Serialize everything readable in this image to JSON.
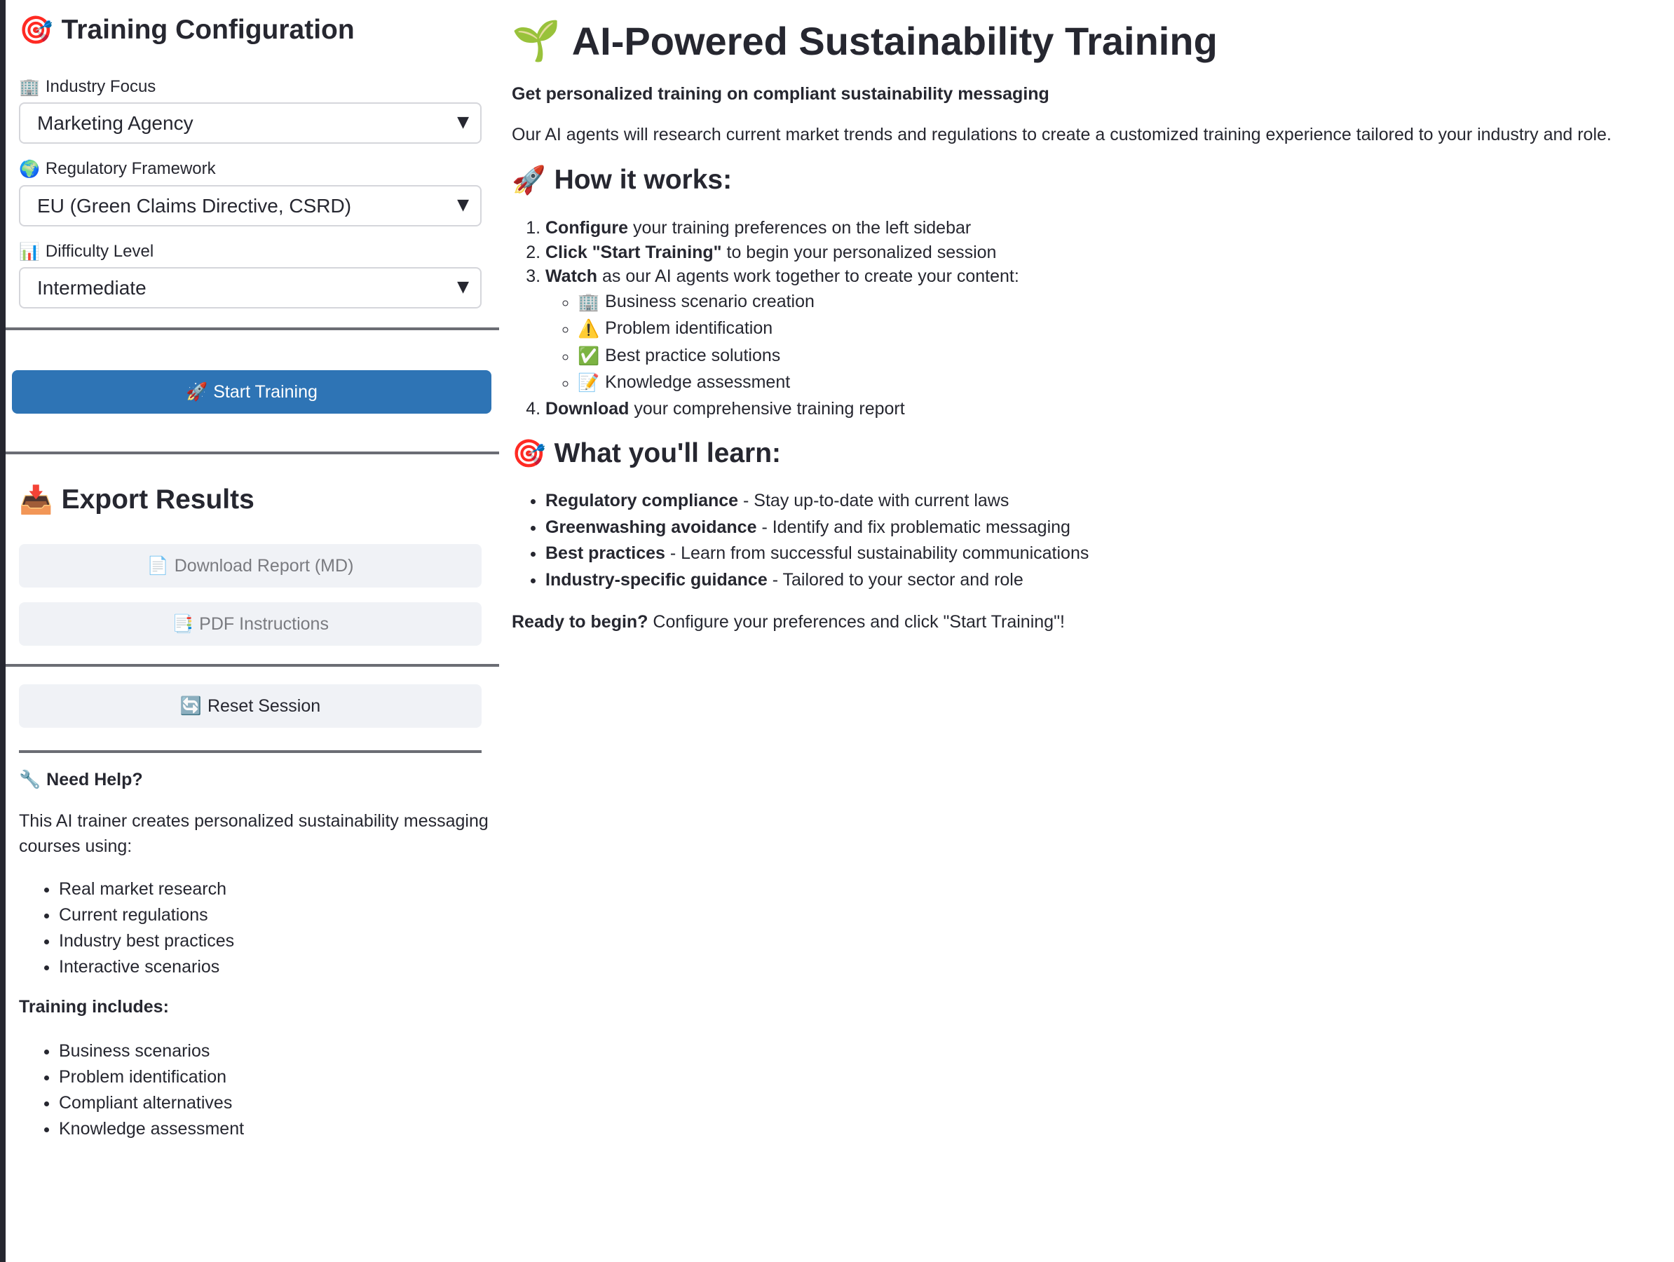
{
  "sidebar": {
    "config_title": "Training Configuration",
    "config_icon": "🎯",
    "fields": [
      {
        "icon": "🏢",
        "label": "Industry Focus",
        "value": "Marketing Agency"
      },
      {
        "icon": "🌍",
        "label": "Regulatory Framework",
        "value": "EU (Green Claims Directive, CSRD)"
      },
      {
        "icon": "📊",
        "label": "Difficulty Level",
        "value": "Intermediate"
      }
    ],
    "start_button": {
      "icon": "🚀",
      "label": "Start Training"
    },
    "export_title": "Export Results",
    "export_icon": "📥",
    "download_button": {
      "icon": "📄",
      "label": "Download Report (MD)"
    },
    "pdf_button": {
      "icon": "📑",
      "label": "PDF Instructions"
    },
    "reset_button": {
      "icon": "🔄",
      "label": "Reset Session"
    },
    "help_title": "Need Help?",
    "help_icon": "🔧",
    "help_text": "This AI trainer creates personalized sustainability messaging courses using:",
    "help_items": [
      "Real market research",
      "Current regulations",
      "Industry best practices",
      "Interactive scenarios"
    ],
    "includes_title": "Training includes:",
    "includes_items": [
      "Business scenarios",
      "Problem identification",
      "Compliant alternatives",
      "Knowledge assessment"
    ]
  },
  "main": {
    "title_icon": "🌱",
    "title": "AI-Powered Sustainability Training",
    "subtitle": "Get personalized training on compliant sustainability messaging",
    "intro": "Our AI agents will research current market trends and regulations to create a customized training experience tailored to your industry and role.",
    "how_icon": "🚀",
    "how_title": "How it works:",
    "steps": [
      {
        "bold": "Configure",
        "text": " your training preferences on the left sidebar"
      },
      {
        "bold": "Click \"Start Training\"",
        "text": " to begin your personalized session"
      },
      {
        "bold": "Watch",
        "text": " as our AI agents work together to create your content:"
      },
      {
        "bold": "Download",
        "text": " your comprehensive training report"
      }
    ],
    "substeps": [
      {
        "icon": "🏢",
        "text": "Business scenario creation"
      },
      {
        "icon": "⚠️",
        "text": "Problem identification"
      },
      {
        "icon": "✅",
        "text": "Best practice solutions"
      },
      {
        "icon": "📝",
        "text": "Knowledge assessment"
      }
    ],
    "learn_icon": "🎯",
    "learn_title": "What you'll learn:",
    "learn_items": [
      {
        "bold": "Regulatory compliance",
        "text": " - Stay up-to-date with current laws"
      },
      {
        "bold": "Greenwashing avoidance",
        "text": " - Identify and fix problematic messaging"
      },
      {
        "bold": "Best practices",
        "text": " - Learn from successful sustainability communications"
      },
      {
        "bold": "Industry-specific guidance",
        "text": " - Tailored to your sector and role"
      }
    ],
    "ready_bold": "Ready to begin?",
    "ready_text": " Configure your preferences and click \"Start Training\"!"
  }
}
